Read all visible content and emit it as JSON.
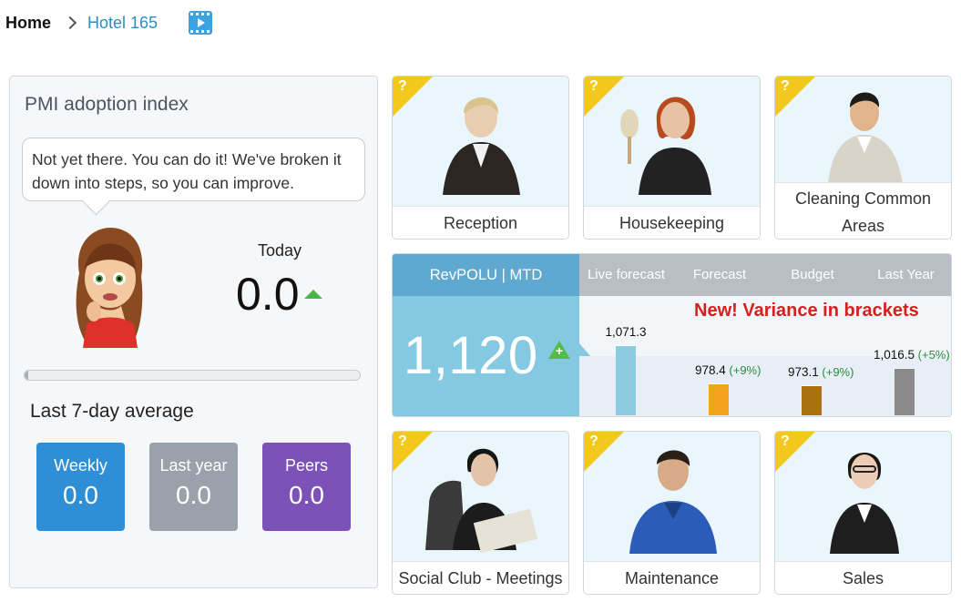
{
  "breadcrumb": {
    "home": "Home",
    "current": "Hotel 165",
    "video_icon": "video-icon"
  },
  "pmi": {
    "title": "PMI adoption index",
    "message": "Not yet there. You can do it! We've broken it down into steps, so you can improve.",
    "today_label": "Today",
    "today_value": "0.0",
    "progress_fraction": 0.01,
    "average_title": "Last 7-day average",
    "tiles": [
      {
        "label": "Weekly",
        "value": "0.0",
        "color": "#2f8fd6"
      },
      {
        "label": "Last year",
        "value": "0.0",
        "color": "#9aa1ab"
      },
      {
        "label": "Peers",
        "value": "0.0",
        "color": "#7c52b8"
      }
    ]
  },
  "cards_top": [
    {
      "label": "Reception",
      "badge": "?"
    },
    {
      "label": "Housekeeping",
      "badge": "?"
    },
    {
      "label": "Cleaning Common Areas",
      "label_line1": "Cleaning Common",
      "label_line2": "Areas",
      "badge": "?"
    }
  ],
  "cards_bottom": [
    {
      "label": "Social Club - Meetings",
      "badge": "?"
    },
    {
      "label": "Maintenance",
      "badge": "?"
    },
    {
      "label": "Sales",
      "badge": "?"
    }
  ],
  "revpolu": {
    "title": "RevPOLU | MTD",
    "value": "1,120",
    "columns": [
      "Live forecast",
      "Forecast",
      "Budget",
      "Last Year"
    ],
    "note": "New!  Variance in brackets",
    "colors": {
      "header": "#5fa8cf",
      "body": "#85c8e2",
      "col_header": "#b9bec4",
      "note": "#d81e1e"
    }
  },
  "chart_data": {
    "type": "bar",
    "categories": [
      "Live forecast",
      "Forecast",
      "Budget",
      "Last Year"
    ],
    "values": [
      1071.3,
      978.4,
      973.1,
      1016.5
    ],
    "labels": [
      "1,071.3",
      "978.4",
      "973.1",
      "1,016.5"
    ],
    "variances": [
      "",
      "(+9%)",
      "(+9%)",
      "(+5%)"
    ],
    "colors": [
      "#8ccbe0",
      "#f5a21e",
      "#a8730f",
      "#8a8a8a"
    ],
    "title": "",
    "xlabel": "",
    "ylabel": ""
  }
}
